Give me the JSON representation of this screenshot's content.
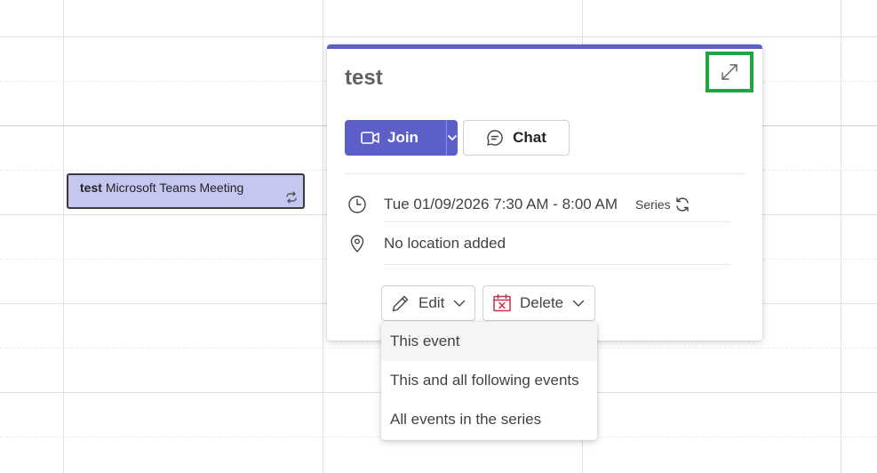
{
  "calendar": {
    "event": {
      "title": "test",
      "subtitle": "Microsoft Teams Meeting",
      "recurring_icon": "recurring-icon"
    }
  },
  "popup": {
    "accent_color": "#5b5fc7",
    "title": "test",
    "expand_icon": "expand-icon",
    "join_label": "Join",
    "chat_label": "Chat",
    "datetime": "Tue 01/09/2026 7:30 AM - 8:00 AM",
    "series_label": "Series",
    "location": "No location added",
    "edit_label": "Edit",
    "delete_label": "Delete"
  },
  "edit_menu": {
    "items": [
      {
        "label": "This event"
      },
      {
        "label": "This and all following events"
      },
      {
        "label": "All events in the series"
      }
    ]
  }
}
